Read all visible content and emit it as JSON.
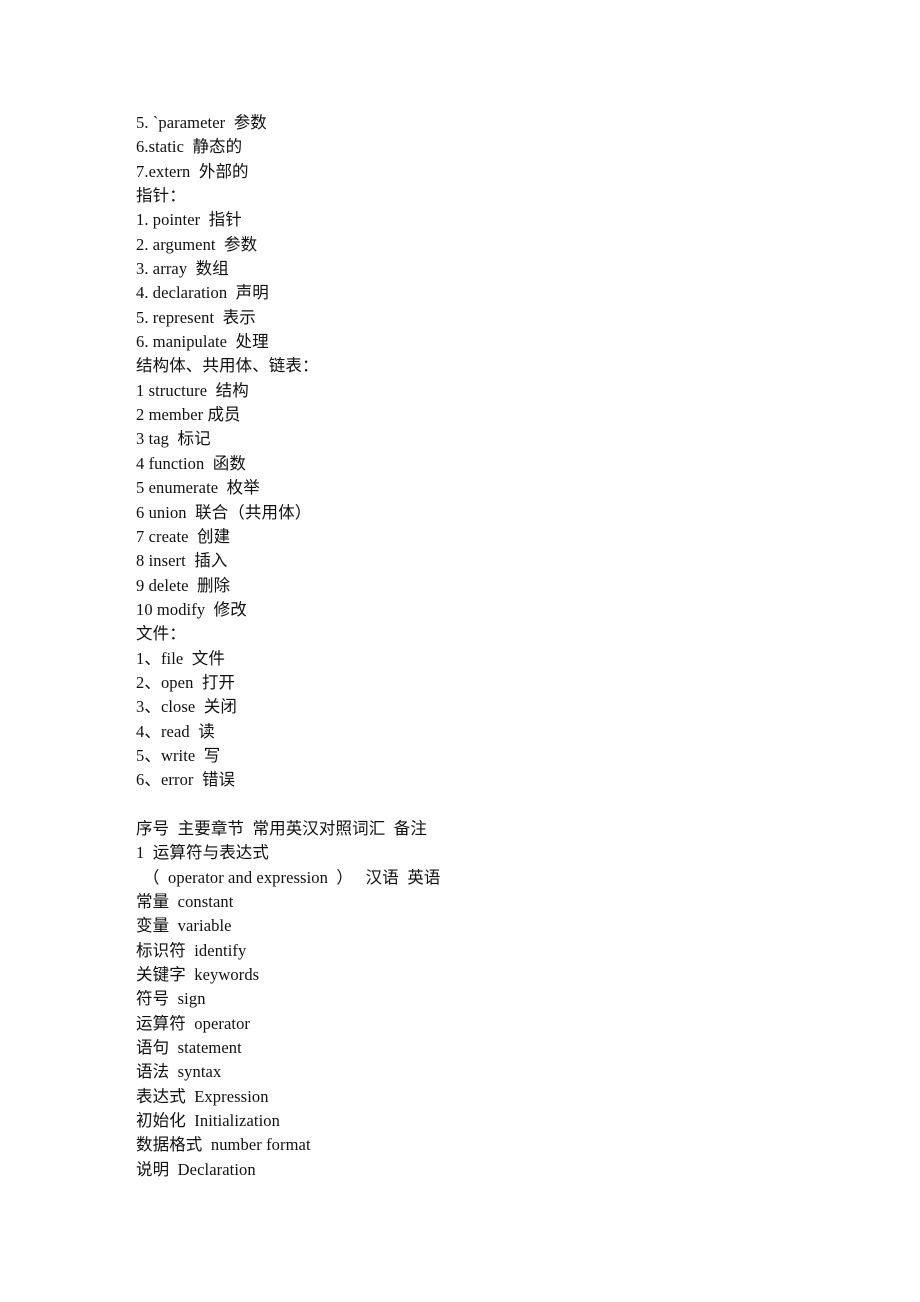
{
  "document": {
    "background_color": "#ffffff",
    "text_color": "#111111",
    "blocks": [
      {
        "name": "storage-class-keywords-tail",
        "lines": [
          "5. `parameter  参数",
          "6.static  静态的",
          "7.extern  外部的"
        ]
      },
      {
        "name": "pointer-section",
        "heading": "指针：",
        "lines": [
          "1. pointer  指针",
          "2. argument  参数",
          "3. array  数组",
          "4. declaration  声明",
          "5. represent  表示",
          "6. manipulate  处理"
        ]
      },
      {
        "name": "struct-union-list-section",
        "heading": "结构体、共用体、链表：",
        "lines": [
          "1 structure  结构",
          "2 member 成员",
          "3 tag  标记",
          "4 function  函数",
          "5 enumerate  枚举",
          "6 union  联合（共用体）",
          "7 create  创建",
          "8 insert  插入",
          "9 delete  删除",
          "10 modify  修改"
        ]
      },
      {
        "name": "file-section",
        "heading": "文件：",
        "lines": [
          "1、file  文件",
          "2、open  打开",
          "3、close  关闭",
          "4、read  读",
          "5、write  写",
          "6、error  错误"
        ]
      },
      {
        "name": "spacer",
        "lines": [
          ""
        ]
      },
      {
        "name": "vocabulary-table-section",
        "lines": [
          "序号  主要章节  常用英汉对照词汇  备注",
          "1  运算符与表达式",
          "（  operator and expression  ）   汉语  英语",
          "常量  constant",
          "变量  variable",
          "标识符  identify",
          "关键字  keywords",
          "符号  sign",
          "运算符  operator",
          "语句  statement",
          "语法  syntax",
          "表达式  Expression",
          "初始化  Initialization",
          "数据格式  number format",
          "说明  Declaration"
        ]
      }
    ],
    "all_lines": [
      "5. `parameter  参数",
      "6.static  静态的",
      "7.extern  外部的",
      "指针：",
      "1. pointer  指针",
      "2. argument  参数",
      "3. array  数组",
      "4. declaration  声明",
      "5. represent  表示",
      "6. manipulate  处理",
      "结构体、共用体、链表：",
      "1 structure  结构",
      "2 member 成员",
      "3 tag  标记",
      "4 function  函数",
      "5 enumerate  枚举",
      "6 union  联合（共用体）",
      "7 create  创建",
      "8 insert  插入",
      "9 delete  删除",
      "10 modify  修改",
      "文件：",
      "1、file  文件",
      "2、open  打开",
      "3、close  关闭",
      "4、read  读",
      "5、write  写",
      "6、error  错误",
      "",
      "序号  主要章节  常用英汉对照词汇  备注",
      "1  运算符与表达式",
      "（  operator and expression  ）   汉语  英语",
      "常量  constant",
      "变量  variable",
      "标识符  identify",
      "关键字  keywords",
      "符号  sign",
      "运算符  operator",
      "语句  statement",
      "语法  syntax",
      "表达式  Expression",
      "初始化  Initialization",
      "数据格式  number format",
      "说明  Declaration"
    ]
  }
}
